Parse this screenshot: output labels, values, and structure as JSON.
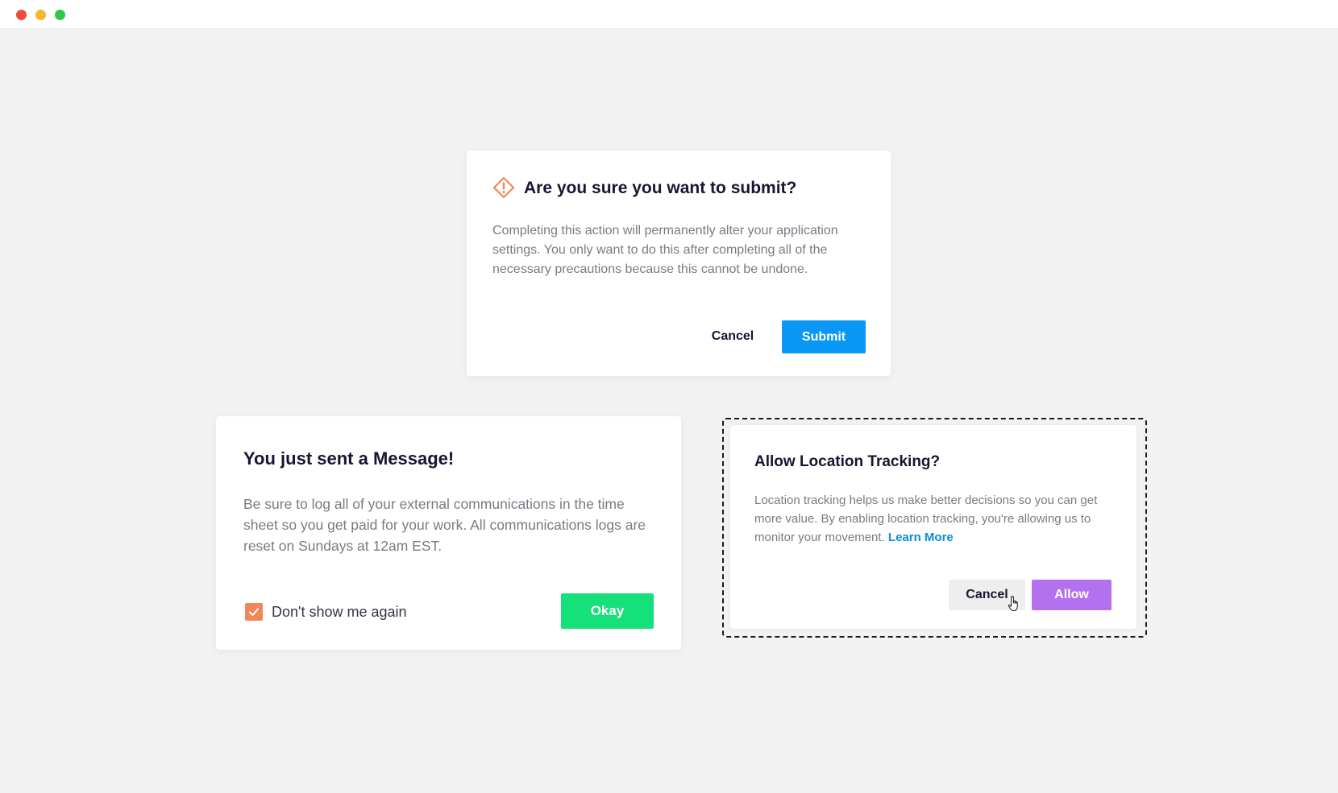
{
  "window": {
    "controls": [
      {
        "name": "close",
        "color": "#ee4c3b"
      },
      {
        "name": "minimize",
        "color": "#f5b72c"
      },
      {
        "name": "zoom",
        "color": "#2ec746"
      }
    ]
  },
  "submit_dialog": {
    "icon": "warning-diamond-icon",
    "title": "Are you sure you want to submit?",
    "body": "Completing this action will permanently alter your application settings. You only want to do this after completing all of the necessary precautions because this cannot be undone.",
    "cancel_label": "Cancel",
    "submit_label": "Submit",
    "accent_color": "#0a97f5"
  },
  "message_dialog": {
    "title": "You just sent a Message!",
    "body": "Be sure to log all of your external communications in the time sheet so you get paid for your work. All communications logs are reset on Sundays at 12am EST.",
    "checkbox_label": "Don't show me again",
    "checkbox_checked": true,
    "okay_label": "Okay",
    "accent_color": "#16e079"
  },
  "location_dialog": {
    "title": "Allow Location Tracking?",
    "body": "Location tracking helps us make better decisions so you can get more value. By enabling location tracking, you're allowing us to monitor your movement.",
    "link_label": "Learn More",
    "cancel_label": "Cancel",
    "allow_label": "Allow",
    "accent_color": "#b471ef",
    "cursor": "hand-pointer-icon"
  }
}
